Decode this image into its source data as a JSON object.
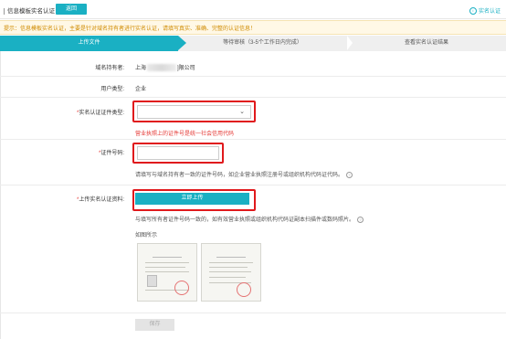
{
  "header": {
    "title": "信息模板实名认证",
    "back_label": "返回",
    "right_link": "实名认证"
  },
  "notice": "提示：信息模板实名认证，主要是针对域名持有者进行实名认证，请填写真实、准确、完整的认证信息！",
  "steps": [
    {
      "label": "上传文件"
    },
    {
      "label": "等待审核（3-5个工作日内完成）"
    },
    {
      "label": "查看实名认证结果"
    }
  ],
  "form": {
    "holder_label": "域名持有者:",
    "holder_prefix": "上海",
    "holder_suffix": "]限公司",
    "user_type_label": "用户类型:",
    "user_type_value": "企业",
    "cert_type_label": "实名认证证件类型:",
    "cert_type_value": "",
    "cert_type_error": "营业执照上的证件号是统一社会信用代码",
    "cert_no_label": "证件号码:",
    "cert_no_value": "",
    "cert_no_hint": "请填写与域名持有者一致的证件号码，如企业营业执照注册号或组织机构代码证代码。",
    "upload_label": "上传实名认证资料:",
    "upload_button": "立即上传",
    "upload_hint": "与填写所有者证件号码一致的，如有效营业执照或组织机构代码证副本扫描件或数码照片。",
    "example_label": "如图所示",
    "save_button": "保存"
  },
  "colors": {
    "accent": "#1ab0c3",
    "error": "#e53935",
    "highlight": "#e0191c",
    "notice_text": "#d08b00"
  }
}
